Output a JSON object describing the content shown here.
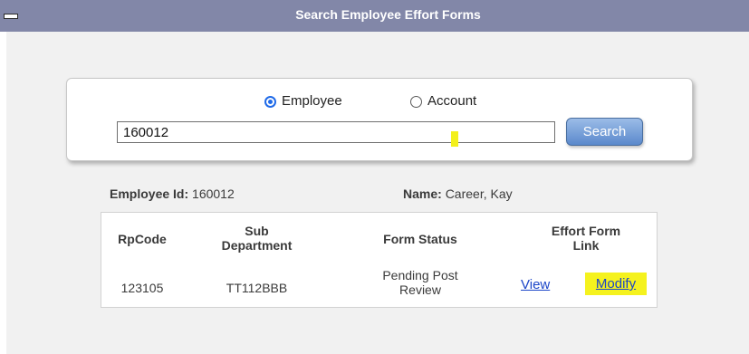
{
  "header": {
    "title": "Search Employee Effort Forms"
  },
  "search": {
    "radio_employee_label": "Employee",
    "radio_account_label": "Account",
    "selected": "Employee",
    "input_value": "160012",
    "button_label": "Search"
  },
  "employee": {
    "id_label": "Employee Id:",
    "id_value": "160012",
    "name_label": "Name:",
    "name_value": "Career, Kay"
  },
  "table": {
    "columns": [
      {
        "line1": "RpCode",
        "line2": ""
      },
      {
        "line1": "Sub",
        "line2": "Department"
      },
      {
        "line1": "Form Status",
        "line2": ""
      },
      {
        "line1": "Effort Form",
        "line2": "Link"
      }
    ],
    "rows": [
      {
        "rpcode": "123105",
        "sub_department": "TT112BBB",
        "status_line1": "Pending Post",
        "status_line2": "Review",
        "view_label": "View",
        "modify_label": "Modify"
      }
    ]
  },
  "colors": {
    "titlebar": "#8287a8",
    "panel": "#f1f1f1",
    "highlight": "#f5f21e",
    "link": "#1a44c8"
  }
}
